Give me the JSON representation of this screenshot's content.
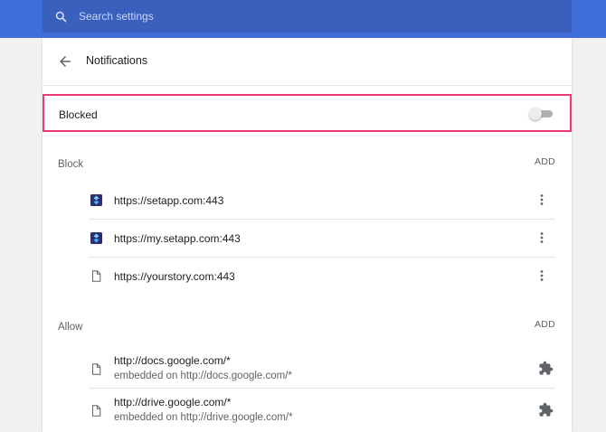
{
  "search": {
    "placeholder": "Search settings",
    "icon": "search-icon"
  },
  "header": {
    "title": "Notifications",
    "back_icon": "back-arrow-icon"
  },
  "blocked_setting": {
    "label": "Blocked",
    "enabled": false,
    "highlight_color": "#f0397a"
  },
  "block_section": {
    "label": "Block",
    "add_label": "ADD",
    "sites": [
      {
        "url": "https://setapp.com:443",
        "icon": "setapp-favicon"
      },
      {
        "url": "https://my.setapp.com:443",
        "icon": "setapp-favicon"
      },
      {
        "url": "https://yourstory.com:443",
        "icon": "file-icon"
      }
    ]
  },
  "allow_section": {
    "label": "Allow",
    "add_label": "ADD",
    "sites": [
      {
        "url": "http://docs.google.com/*",
        "sub": "embedded on http://docs.google.com/*",
        "icon": "extension-puzzle-icon"
      },
      {
        "url": "http://drive.google.com/*",
        "sub": "embedded on http://drive.google.com/*",
        "icon": "extension-puzzle-icon"
      }
    ]
  },
  "colors": {
    "topbar": "#3e6fd8",
    "searchbox": "#3a5fbd",
    "accent_highlight": "#f0397a"
  }
}
